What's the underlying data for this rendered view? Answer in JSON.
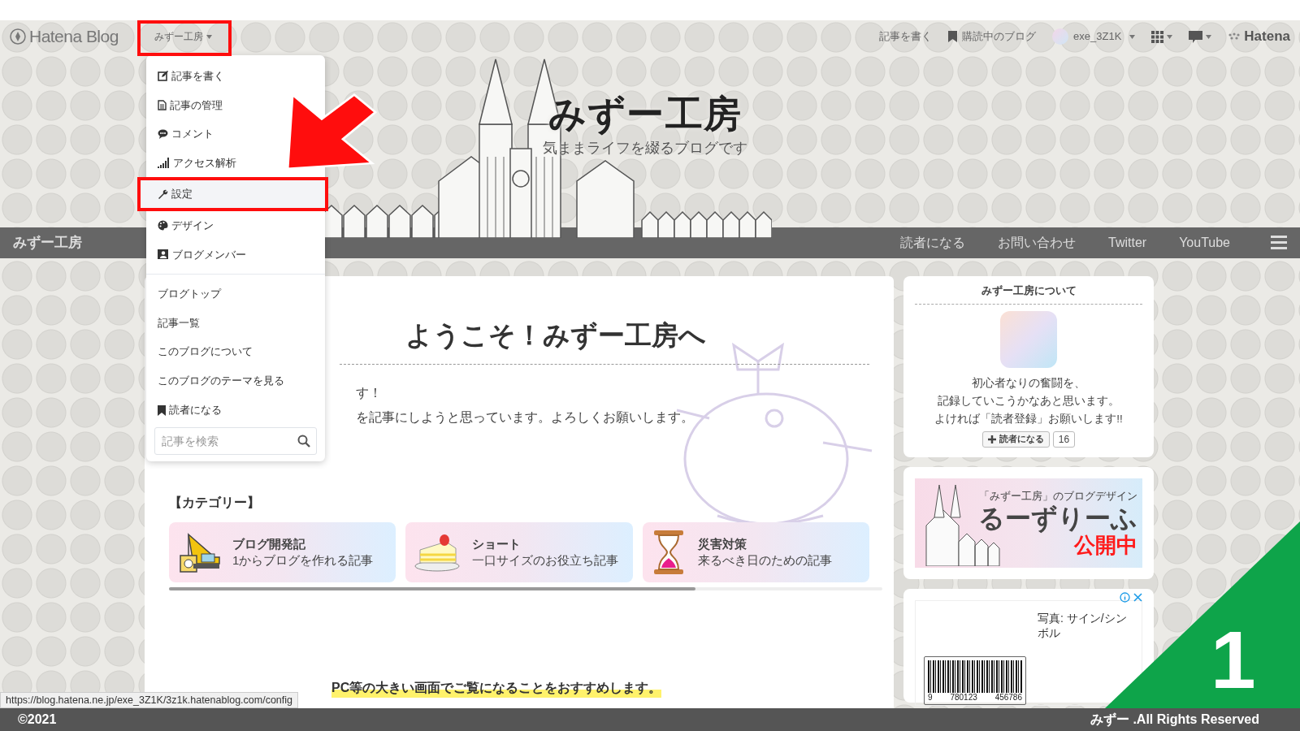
{
  "topbar": {
    "logo": "Hatena Blog",
    "blog_menu": "みずー工房",
    "links": [
      {
        "kind": "text",
        "label": "記事を書く"
      },
      {
        "kind": "bookmark",
        "label": "購読中のブログ"
      },
      {
        "kind": "user",
        "label": "exe_3Z1K"
      }
    ],
    "brand": "Hatena"
  },
  "header": {
    "title": "みずー工房",
    "subtitle": "気ままライフを綴るブログです"
  },
  "navbar": {
    "title": "みずー工房",
    "links": [
      "読者になる",
      "お問い合わせ",
      "Twitter",
      "YouTube"
    ]
  },
  "dropdown": {
    "tools": [
      {
        "kind": "edit",
        "label": "記事を書く",
        "selected": false
      },
      {
        "kind": "document",
        "label": "記事の管理",
        "selected": false
      },
      {
        "kind": "comment",
        "label": "コメント",
        "selected": false
      },
      {
        "kind": "bars",
        "label": "アクセス解析",
        "selected": false
      },
      {
        "kind": "wrench",
        "label": "設定",
        "selected": true
      },
      {
        "kind": "palette",
        "label": "デザイン",
        "selected": false
      },
      {
        "kind": "member",
        "label": "ブログメンバー",
        "selected": false
      }
    ],
    "links": [
      "ブログトップ",
      "記事一覧",
      "このブログについて",
      "このブログのテーマを見る"
    ],
    "subscribe": "読者になる",
    "search": {
      "placeholder": "記事を検索"
    }
  },
  "article": {
    "title": "ようこそ！みずー工房へ",
    "lines": [
      "す！",
      "を記事にしようと思っています。よろしくお願いします。"
    ],
    "category_heading": "【カテゴリー】",
    "categories": [
      {
        "kind": "crane",
        "title": "ブログ開発記",
        "subtitle": "1からブログを作れる記事"
      },
      {
        "kind": "cake",
        "title": "ショート",
        "subtitle": "一口サイズのお役立ち記事"
      },
      {
        "kind": "hourglass",
        "title": "災害対策",
        "subtitle": "来るべき日のための記事"
      }
    ],
    "notice": "PC等の大きい画面でご覧になることをおすすめします。"
  },
  "sidebar": {
    "about": {
      "title": "みずー工房について",
      "text": [
        "初心者なりの奮闘を、",
        "記録していこうかなあと思います。",
        "よければ「読者登録」お願いします!!"
      ],
      "subscribe_button": "読者になる",
      "subscriber_count": "16"
    },
    "banner": {
      "caption": "「みずー工房」のブログデザイン",
      "title": "るーずりーふ",
      "badge": "公開中"
    },
    "ad": {
      "text": "写真: サイン/シンボル",
      "barcode_digits": [
        "9",
        "780123",
        "456786"
      ]
    }
  },
  "status_url": "https://blog.hatena.ne.jp/exe_3Z1K/3z1k.hatenablog.com/config",
  "footer": {
    "copyright": "©2021",
    "rights_name": "みずー",
    "rights": ".All Rights Reserved"
  },
  "step_badge": "1"
}
